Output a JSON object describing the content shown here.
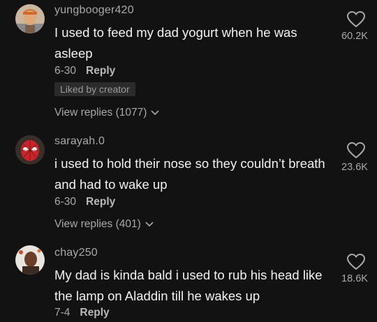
{
  "comments": [
    {
      "username": "yungbooger420",
      "text": "I used to feed my dad yogurt when he was asleep",
      "date": "6-30",
      "reply_label": "Reply",
      "liked_badge": "Liked by creator",
      "view_replies": "View replies (1077)",
      "likes": "60.2K",
      "avatar_icon": "cartoon-avatar-icon"
    },
    {
      "username": "sarayah.0",
      "text": "i used to hold their nose so they couldn’t breath and had to wake up",
      "date": "6-30",
      "reply_label": "Reply",
      "view_replies": "View replies (401)",
      "likes": "23.6K",
      "avatar_icon": "spiderman-avatar-icon"
    },
    {
      "username": "chay250",
      "text": "My dad is kinda bald i used to rub his head like the lamp on Aladdin till he wakes up",
      "date": "7-4",
      "reply_label": "Reply",
      "likes": "18.6K",
      "avatar_icon": "photo-avatar-icon"
    }
  ],
  "colors": {
    "background": "#121212",
    "primary_text": "#f2f2f2",
    "secondary_text": "#a9a9a9"
  }
}
